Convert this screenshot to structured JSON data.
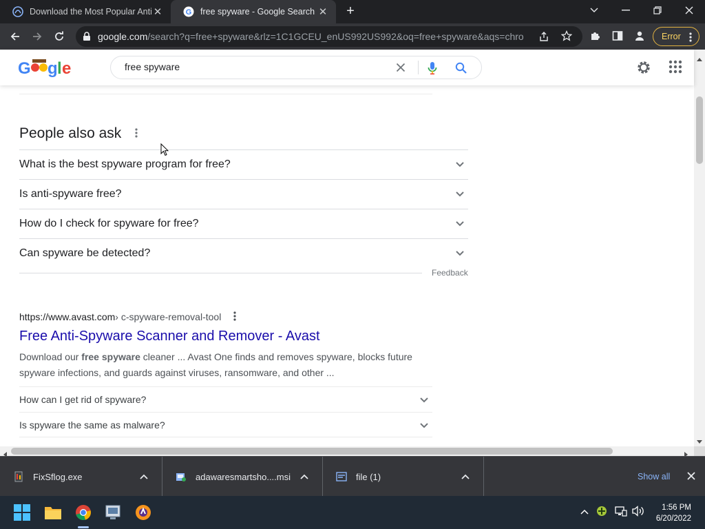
{
  "browser": {
    "tabs": [
      {
        "title": "Download the Most Popular Anti",
        "active": false
      },
      {
        "title": "free spyware - Google Search",
        "active": true
      }
    ],
    "address": {
      "host": "google.com",
      "path": "/search?q=free+spyware&rlz=1C1GCEU_enUS992US992&oq=free+spyware&aqs=chro..."
    },
    "profile_status": "Error"
  },
  "google": {
    "query": "free spyware"
  },
  "paa": {
    "title": "People also ask",
    "questions": [
      "What is the best spyware program for free?",
      "Is anti-spyware free?",
      "How do I check for spyware for free?",
      "Can spyware be detected?"
    ],
    "feedback": "Feedback"
  },
  "result": {
    "cite_domain": "https://www.avast.com",
    "cite_path": " › c-spyware-removal-tool",
    "title": "Free Anti-Spyware Scanner and Remover - Avast",
    "snippet_before": "Download our ",
    "snippet_bold": "free spyware",
    "snippet_after": " cleaner ... Avast One finds and removes spyware, blocks future spyware infections, and guards against viruses, ransomware, and other ...",
    "sub_questions": [
      "How can I get rid of spyware?",
      "Is spyware the same as malware?"
    ]
  },
  "downloads": {
    "items": [
      {
        "name": "FixSflog.exe"
      },
      {
        "name": "adawaresmartsho....msi"
      },
      {
        "name": "file (1)"
      }
    ],
    "show_all": "Show all"
  },
  "taskbar": {
    "time": "1:56 PM",
    "date": "6/20/2022"
  },
  "colors": {
    "link": "#1a0dab",
    "chrome_dark": "#202124",
    "chrome_toolbar": "#35363a",
    "error_accent": "#fdd663",
    "google_blue": "#4285f4"
  }
}
